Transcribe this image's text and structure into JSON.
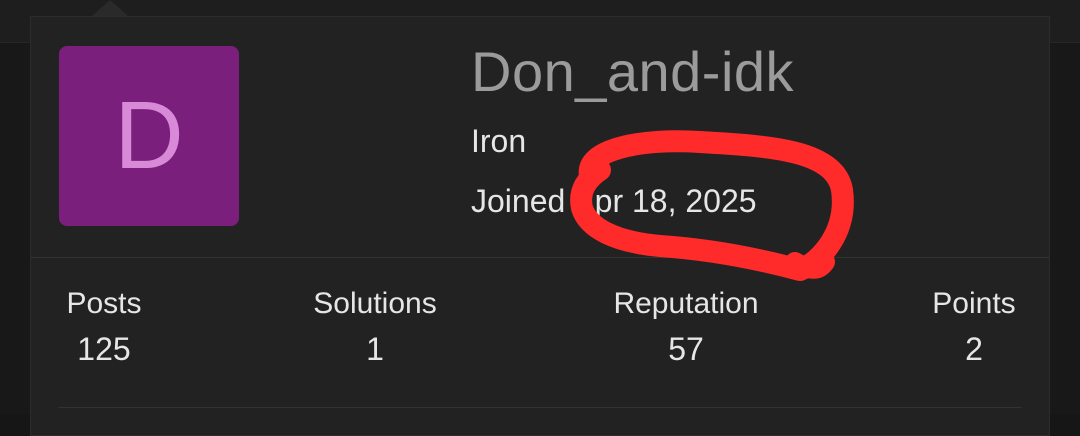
{
  "profile": {
    "avatar_letter": "D",
    "username": "Don_and-idk",
    "rank": "Iron",
    "joined_label": "Joined",
    "joined_date": "Apr 18, 2025"
  },
  "stats": [
    {
      "label": "Posts",
      "value": "125"
    },
    {
      "label": "Solutions",
      "value": "1"
    },
    {
      "label": "Reputation",
      "value": "57"
    },
    {
      "label": "Points",
      "value": "2"
    }
  ],
  "colors": {
    "avatar_bg": "#7a1f7c",
    "avatar_letter": "#d88ad9",
    "card_bg": "#222222",
    "annotation_stroke": "#ff2a2a"
  }
}
